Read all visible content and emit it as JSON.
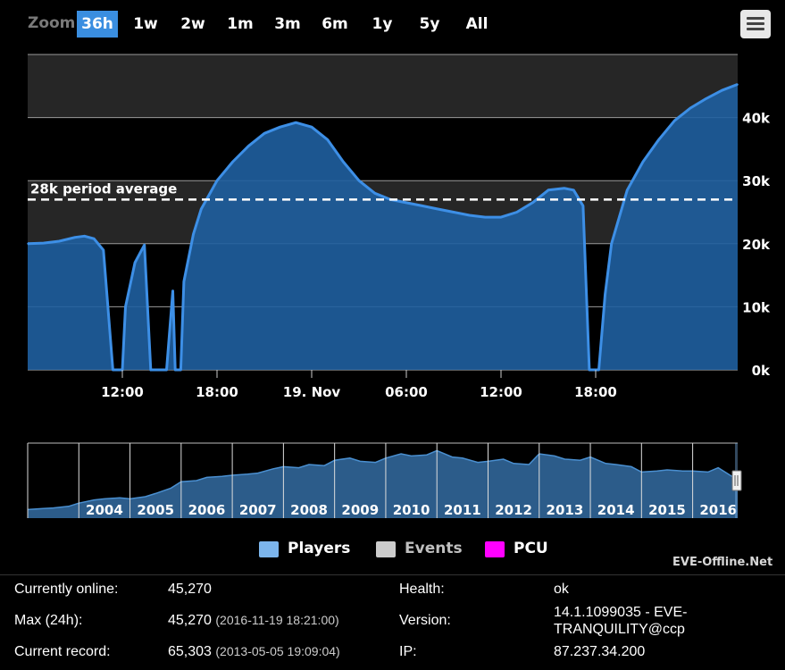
{
  "zoom": {
    "label": "Zoom",
    "buttons": [
      "36h",
      "1w",
      "2w",
      "1m",
      "3m",
      "6m",
      "1y",
      "5y",
      "All"
    ],
    "active": "36h"
  },
  "menu_icon": "hamburger-menu-icon",
  "colors": {
    "players": "#7cb5ec",
    "events": "#cccccc",
    "pcu": "#ff00ff",
    "series_line": "#3d8fe6",
    "series_fill": "#1f5fa0",
    "navigator_fill": "#2c5c8a",
    "active_zoom": "#3a8ee0"
  },
  "chart_data": [
    {
      "type": "area",
      "x_unit": "hours since 18 Nov 06:00",
      "x": [
        0,
        1,
        2,
        3,
        3.6,
        4.2,
        4.8,
        5.4,
        5.8,
        6.0,
        6.2,
        6.8,
        7.4,
        7.8,
        8.0,
        8.2,
        8.8,
        9.2,
        9.35,
        9.5,
        9.7,
        9.9,
        10.5,
        11.0,
        12,
        13,
        14,
        15,
        16,
        17,
        18,
        19,
        20,
        21,
        22,
        23,
        24,
        25,
        26,
        27,
        28,
        29,
        30,
        31,
        32,
        33,
        34,
        34.6,
        35.2,
        35.6,
        35.9,
        36.2,
        36.6,
        37,
        38,
        39,
        40,
        41,
        42,
        43,
        44,
        45
      ],
      "series": [
        {
          "values": [
            20000,
            20100,
            20400,
            21000,
            21200,
            20800,
            19000,
            0,
            0,
            0,
            10000,
            17000,
            19800,
            0,
            0,
            0,
            0,
            12500,
            0,
            0,
            0,
            14000,
            21500,
            25500,
            30000,
            33000,
            35500,
            37500,
            38500,
            39200,
            38500,
            36500,
            33000,
            30000,
            28000,
            27000,
            26500,
            26000,
            25500,
            25000,
            24500,
            24200,
            24200,
            25000,
            26500,
            28500,
            28800,
            28500,
            26000,
            0,
            0,
            0,
            12000,
            20000,
            28500,
            33000,
            36500,
            39500,
            41500,
            43000,
            44300,
            45270
          ]
        }
      ],
      "reference_line": {
        "value": 27000,
        "label": "28k period average"
      },
      "x_tick_labels": [
        "12:00",
        "18:00",
        "19. Nov",
        "06:00",
        "12:00",
        "18:00"
      ],
      "y_tick_labels": [
        "0k",
        "10k",
        "20k",
        "30k",
        "40k"
      ],
      "ylim": [
        0,
        50000
      ],
      "plot_bands": [
        [
          40000,
          50000
        ],
        [
          20000,
          30000
        ]
      ],
      "grid": true
    },
    {
      "type": "area",
      "x": [
        2003.0,
        2003.3,
        2003.5,
        2003.8,
        2004.0,
        2004.3,
        2004.5,
        2004.8,
        2005.0,
        2005.3,
        2005.5,
        2005.8,
        2006.0,
        2006.3,
        2006.5,
        2006.8,
        2007.0,
        2007.3,
        2007.5,
        2007.8,
        2008.0,
        2008.3,
        2008.5,
        2008.8,
        2009.0,
        2009.3,
        2009.5,
        2009.8,
        2010.0,
        2010.3,
        2010.5,
        2010.8,
        2011.0,
        2011.3,
        2011.5,
        2011.8,
        2012.0,
        2012.3,
        2012.5,
        2012.8,
        2013.0,
        2013.3,
        2013.5,
        2013.8,
        2014.0,
        2014.3,
        2014.5,
        2014.8,
        2015.0,
        2015.3,
        2015.5,
        2015.8,
        2016.0,
        2016.3,
        2016.5,
        2016.8,
        2016.88
      ],
      "series": [
        {
          "values": [
            8000,
            9000,
            9500,
            11000,
            14000,
            17000,
            18000,
            19000,
            18000,
            20000,
            23000,
            28000,
            34000,
            35000,
            38000,
            39000,
            40000,
            41000,
            42000,
            46000,
            48000,
            47000,
            50000,
            49000,
            54000,
            56000,
            53000,
            52000,
            56000,
            60000,
            58000,
            59000,
            63000,
            57000,
            56000,
            52000,
            53000,
            55000,
            51000,
            50000,
            60000,
            58000,
            55000,
            54000,
            57000,
            51000,
            50000,
            48000,
            43000,
            44000,
            45000,
            44000,
            44000,
            43000,
            47000,
            38000,
            44000
          ]
        }
      ],
      "x_tick_labels": [
        "2004",
        "2005",
        "2006",
        "2007",
        "2008",
        "2009",
        "2010",
        "2011",
        "2012",
        "2013",
        "2014",
        "2015",
        "2016"
      ],
      "ylim": [
        0,
        70000
      ]
    }
  ],
  "legend": [
    {
      "label": "Players",
      "color": "#7cb5ec"
    },
    {
      "label": "Events",
      "color": "#cccccc"
    },
    {
      "label": "PCU",
      "color": "#ff00ff"
    }
  ],
  "credit": "EVE-Offline.Net",
  "info": {
    "currently_online_label": "Currently online:",
    "currently_online_value": "45,270",
    "max_label": "Max (24h):",
    "max_value": "45,270",
    "max_time": "(2016-11-19 18:21:00)",
    "record_label": "Current record:",
    "record_value": "65,303",
    "record_time": "(2013-05-05 19:09:04)",
    "health_label": "Health:",
    "health_value": "ok",
    "version_label": "Version:",
    "version_value": "14.1.1099035 - EVE-TRANQUILITY@ccp",
    "ip_label": "IP:",
    "ip_value": "87.237.34.200"
  }
}
